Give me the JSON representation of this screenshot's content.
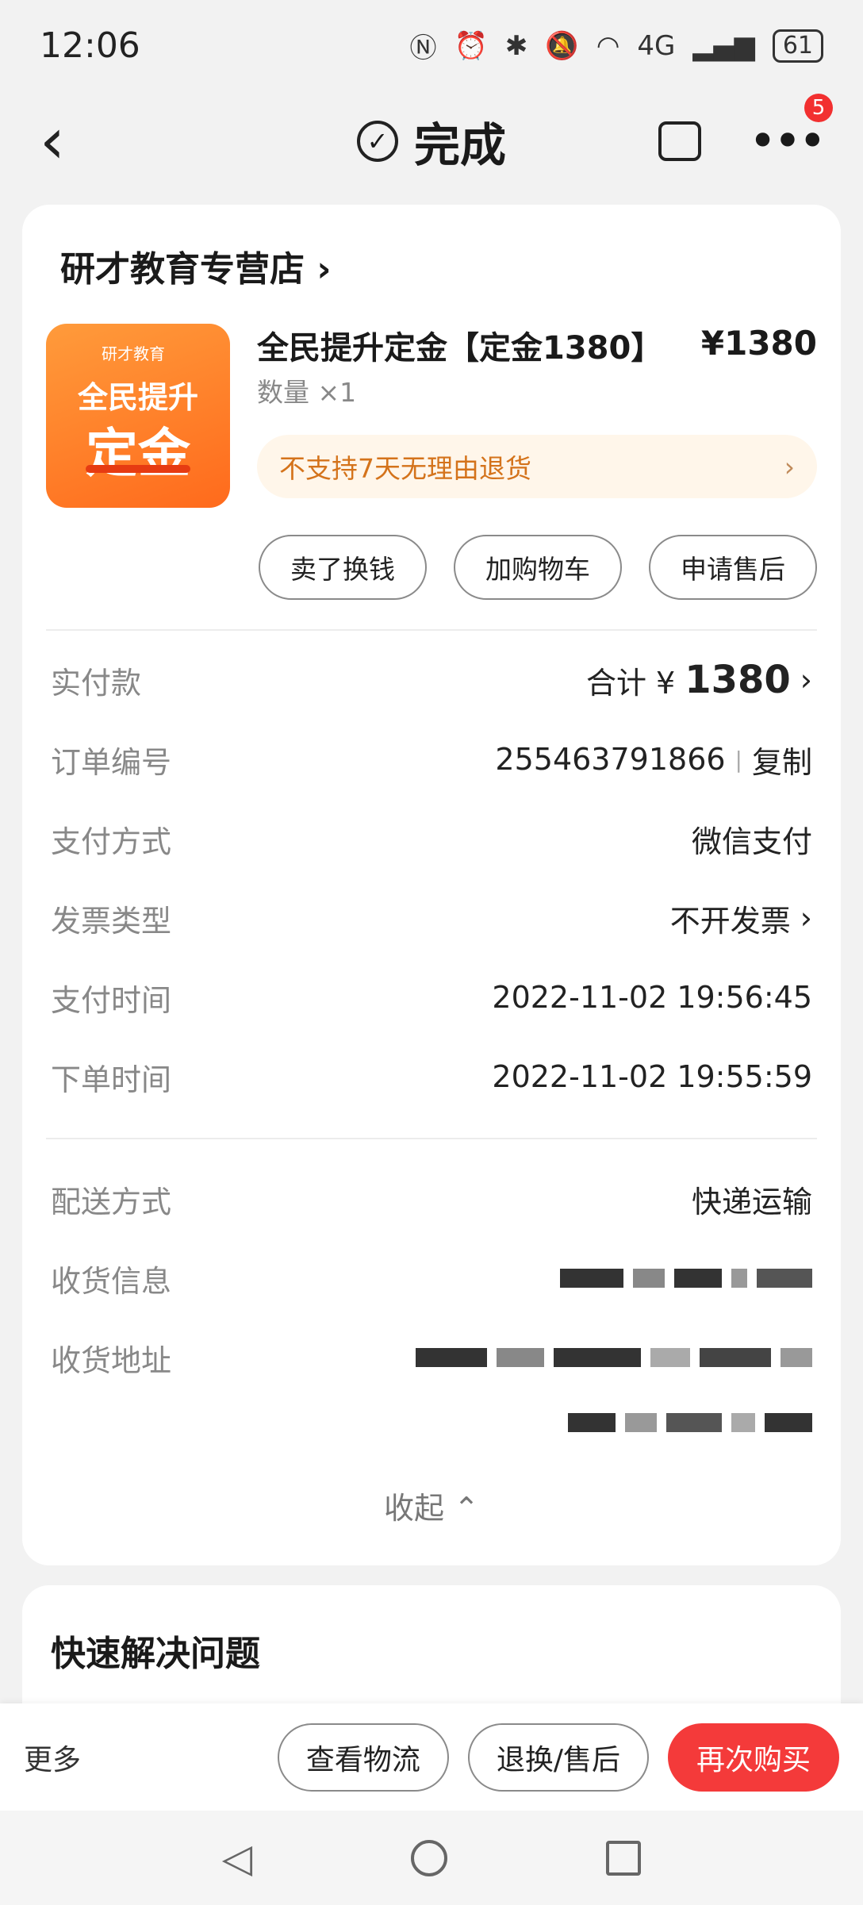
{
  "status_bar": {
    "time": "12:06",
    "battery": "61",
    "network": "4G"
  },
  "header": {
    "title": "完成",
    "badge_count": "5"
  },
  "order": {
    "shop_name": "研才教育专营店",
    "product": {
      "image_brand": "研才教育",
      "image_line1": "全民提升",
      "image_line2": "定金",
      "name": "全民提升定金【定金1380】",
      "price": "¥1380",
      "quantity": "数量 ×1",
      "notice": "不支持7天无理由退货"
    },
    "actions": [
      "卖了换钱",
      "加购物车",
      "申请售后"
    ],
    "details": {
      "paid_label": "实付款",
      "paid_prefix": "合计 ¥",
      "paid_value": "1380",
      "order_no_label": "订单编号",
      "order_no": "255463791866",
      "copy": "复制",
      "pay_method_label": "支付方式",
      "pay_method": "微信支付",
      "invoice_label": "发票类型",
      "invoice": "不开发票",
      "pay_time_label": "支付时间",
      "pay_time": "2022-11-02 19:56:45",
      "order_time_label": "下单时间",
      "order_time": "2022-11-02 19:55:59",
      "delivery_label": "配送方式",
      "delivery": "快递运输",
      "receiver_label": "收货信息",
      "address_label": "收货地址"
    },
    "collapse": "收起"
  },
  "quick": {
    "title": "快速解决问题"
  },
  "bottom_bar": {
    "more": "更多",
    "logistics": "查看物流",
    "return": "退换/售后",
    "rebuy": "再次购买"
  }
}
